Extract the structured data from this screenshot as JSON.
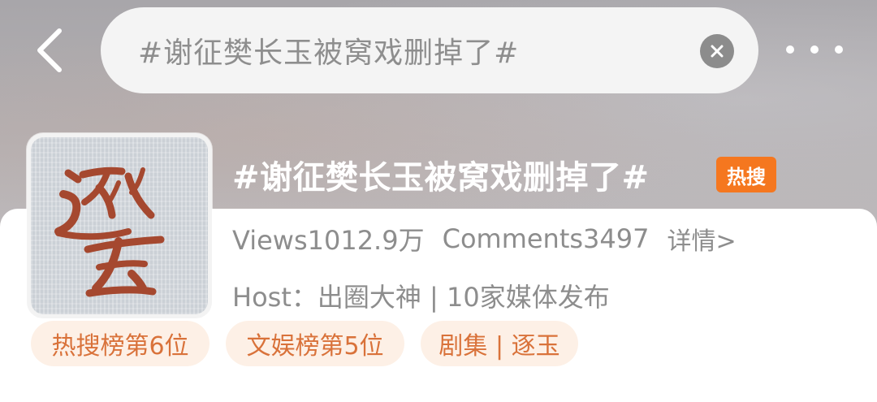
{
  "search": {
    "query": "#谢征樊长玉被窝戏删掉了#"
  },
  "topic": {
    "title": "#谢征樊长玉被窝戏删掉了#",
    "badge": "热搜",
    "views": "Views1012.9万",
    "comments": "Comments3497",
    "detail_link": "详情>",
    "host": "Host：出圈大神 | 10家媒体发布"
  },
  "tags": [
    {
      "label": "热搜榜第6位"
    },
    {
      "label": "文娱榜第5位"
    },
    {
      "label": "剧集 | 逐玉"
    }
  ],
  "cover": {
    "calligraphy": "逐玉",
    "ink_color": "#a5482f"
  },
  "colors": {
    "badge": "#f5771f",
    "tag_bg": "#fdf0e6",
    "tag_text": "#d9723a",
    "meta_text": "#8d8d8d"
  }
}
